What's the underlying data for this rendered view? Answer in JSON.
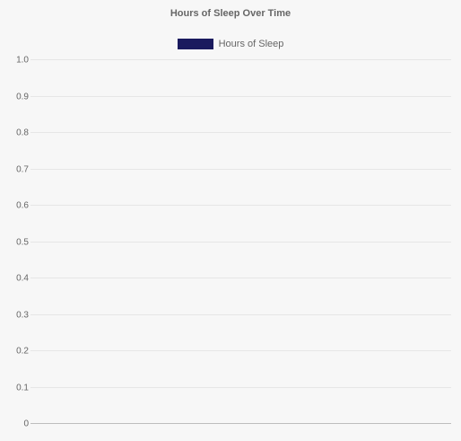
{
  "chart_data": {
    "type": "line",
    "title": "Hours of Sleep Over Time",
    "xlabel": "",
    "ylabel": "",
    "ylim": [
      0,
      1
    ],
    "yticks": [
      "0",
      "0.1",
      "0.2",
      "0.3",
      "0.4",
      "0.5",
      "0.6",
      "0.7",
      "0.8",
      "0.9",
      "1.0"
    ],
    "grid": true,
    "legend_position": "top",
    "series": [
      {
        "name": "Hours of Sleep",
        "color": "#1a1a5e",
        "values": []
      }
    ],
    "categories": []
  },
  "colors": {
    "grid": "#e6e6e6",
    "axis": "#bdbdbd",
    "text": "#666666",
    "background": "#f7f7f7"
  }
}
